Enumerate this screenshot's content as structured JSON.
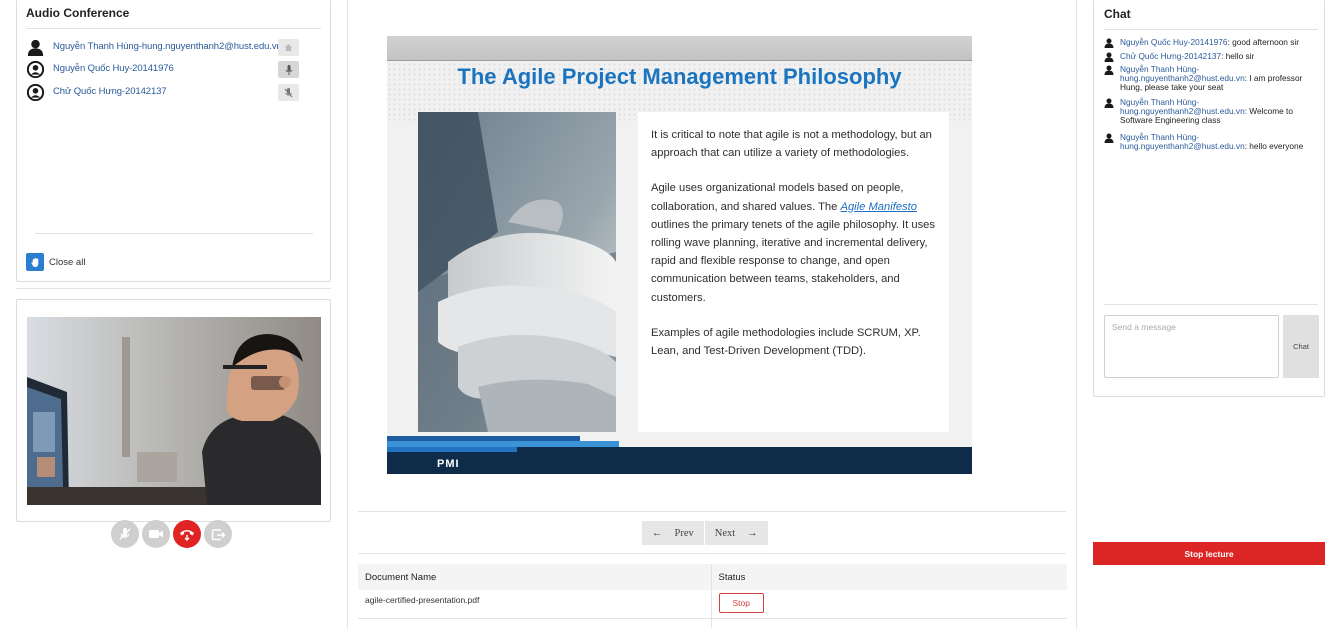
{
  "audio_conference": {
    "title": "Audio Conference",
    "participants": [
      {
        "name": "Nguyễn Thanh Hùng-hung.nguyenthanh2@hust.edu.vn",
        "control_icon": "home-icon"
      },
      {
        "name": "Nguyễn Quốc Huy-20141976",
        "control_icon": "microphone-icon"
      },
      {
        "name": "Chử Quốc Hưng-20142137",
        "control_icon": "microphone-muted-icon"
      }
    ],
    "close_all_label": "Close all"
  },
  "call_controls": [
    "microphone-muted-icon",
    "video-camera-icon",
    "hang-up-icon",
    "share-screen-icon"
  ],
  "slide": {
    "title": "The Agile Project Management Philosophy",
    "paragraph_1": "It is critical to note that agile is not a methodology, but an approach that can utilize a variety of methodologies.",
    "paragraph_2_before": "Agile uses organizational models based on people, collaboration, and shared values. The ",
    "paragraph_2_link": "Agile Manifesto",
    "paragraph_2_after": " outlines the primary tenets of the agile philosophy. It uses rolling wave planning, iterative and incremental delivery, rapid and flexible response to change, and open communication between teams, stakeholders, and customers.",
    "paragraph_3": "Examples of agile methodologies include SCRUM, XP. Lean, and Test-Driven Development (TDD).",
    "footer_logo": "PMI"
  },
  "pager": {
    "prev_label": "Prev",
    "next_label": "Next"
  },
  "documents": {
    "headers": {
      "name": "Document Name",
      "status": "Status"
    },
    "rows": [
      {
        "name": "agile-certified-presentation.pdf",
        "action": "Stop"
      }
    ]
  },
  "chat": {
    "title": "Chat",
    "messages": [
      {
        "user": "Nguyễn Quốc Huy-20141976",
        "text": ": good afternoon sir"
      },
      {
        "user": "Chử Quốc Hưng-20142137",
        "text": ": hello sir"
      },
      {
        "user": "Nguyễn Thanh Hùng-hung.nguyenthanh2@hust.edu.vn",
        "text": ": I am professor Hung, please take your seat"
      },
      {
        "user": "Nguyễn Thanh Hùng-hung.nguyenthanh2@hust.edu.vn",
        "text": ": Welcome to Software Engineering class"
      },
      {
        "user": "Nguyễn Thanh Hùng-hung.nguyenthanh2@hust.edu.vn",
        "text": ": hello everyone"
      }
    ],
    "input_placeholder": "Send a message",
    "send_label": "Chat"
  },
  "stop_lecture_label": "Stop lecture",
  "colors": {
    "accent_blue": "#2a7ed0",
    "danger_red": "#dc2626",
    "slide_title_blue": "#1b74bf"
  }
}
